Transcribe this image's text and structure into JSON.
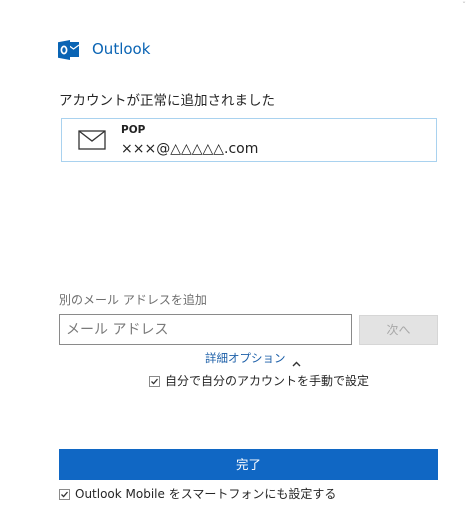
{
  "brand": {
    "name": "Outlook",
    "logo_icon": "outlook-logo-icon",
    "color": "#0a64b4"
  },
  "status": {
    "success_text": "アカウントが正常に追加されました"
  },
  "account": {
    "type": "POP",
    "email": "×××@△△△△△.com",
    "icon": "mail-icon",
    "border_color": "#a9d2ef"
  },
  "add_account": {
    "label": "別のメール アドレスを追加",
    "input_placeholder": "メール アドレス",
    "input_value": "",
    "next_label": "次へ"
  },
  "advanced": {
    "label": "詳細オプション",
    "expanded": true,
    "manual_setup_label": "自分で自分のアカウントを手動で設定",
    "manual_setup_checked": true
  },
  "footer": {
    "done_label": "完了",
    "done_color": "#1067c4",
    "mobile_setup_label": "Outlook Mobile をスマートフォンにも設定する",
    "mobile_setup_checked": true
  }
}
